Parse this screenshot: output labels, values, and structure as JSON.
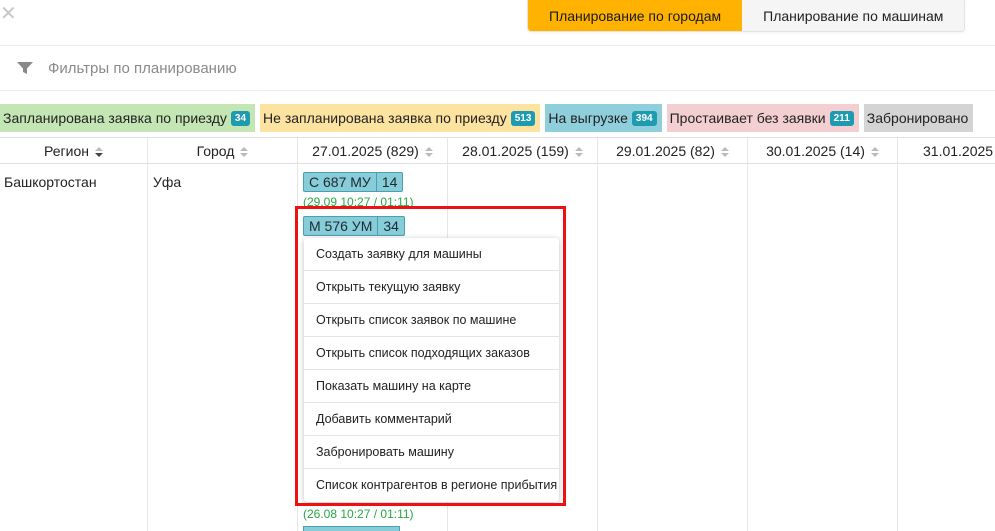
{
  "mode_toggle": {
    "by_city": "Планирование по городам",
    "by_car": "Планирование по машинам",
    "active": "by_city"
  },
  "filters": {
    "label": "Фильтры по планированию",
    "icon": "filter-icon"
  },
  "legend": [
    {
      "label": "Запланирована заявка по приезду",
      "count": "34",
      "color": "#c4e6b4"
    },
    {
      "label": "Не запланирована заявка по приезду",
      "count": "513",
      "color": "#fde3a0"
    },
    {
      "label": "На выгрузке",
      "count": "394",
      "color": "#8fcfdb"
    },
    {
      "label": "Простаивает без заявки",
      "count": "211",
      "color": "#f3cfd2"
    },
    {
      "label": "Забронировано",
      "count": "",
      "color": "#d4d4d4"
    }
  ],
  "table": {
    "columns": [
      {
        "label": "Регион",
        "sort": "desc"
      },
      {
        "label": "Город",
        "sort": "none"
      },
      {
        "label": "27.01.2025 (829)",
        "sort": "none"
      },
      {
        "label": "28.01.2025 (159)",
        "sort": "none"
      },
      {
        "label": "29.01.2025 (82)",
        "sort": "none"
      },
      {
        "label": "30.01.2025 (14)",
        "sort": "none"
      },
      {
        "label": "31.01.2025",
        "sort": "none"
      }
    ],
    "row": {
      "region": "Башкортостан",
      "city": "Уфа",
      "cars": [
        {
          "number": "С 687 МУ",
          "days": "14",
          "time": "(29.09 10:27 / 01:11)"
        },
        {
          "number": "М 576 УМ",
          "days": "34",
          "time": "(26.08 10:27 / 01:11)"
        }
      ]
    }
  },
  "context_menu": {
    "items": [
      "Создать заявку для машины",
      "Открыть текущую заявку",
      "Открыть список заявок по машине",
      "Открыть список подходящих заказов",
      "Показать машину на карте",
      "Добавить комментарий",
      "Забронировать машину",
      "Список контрагентов в регионе прибытия"
    ]
  },
  "colors": {
    "accent": "#ffb300",
    "chip": "#87ccd9",
    "time_text": "#28a745",
    "highlight": "#ee1111"
  }
}
